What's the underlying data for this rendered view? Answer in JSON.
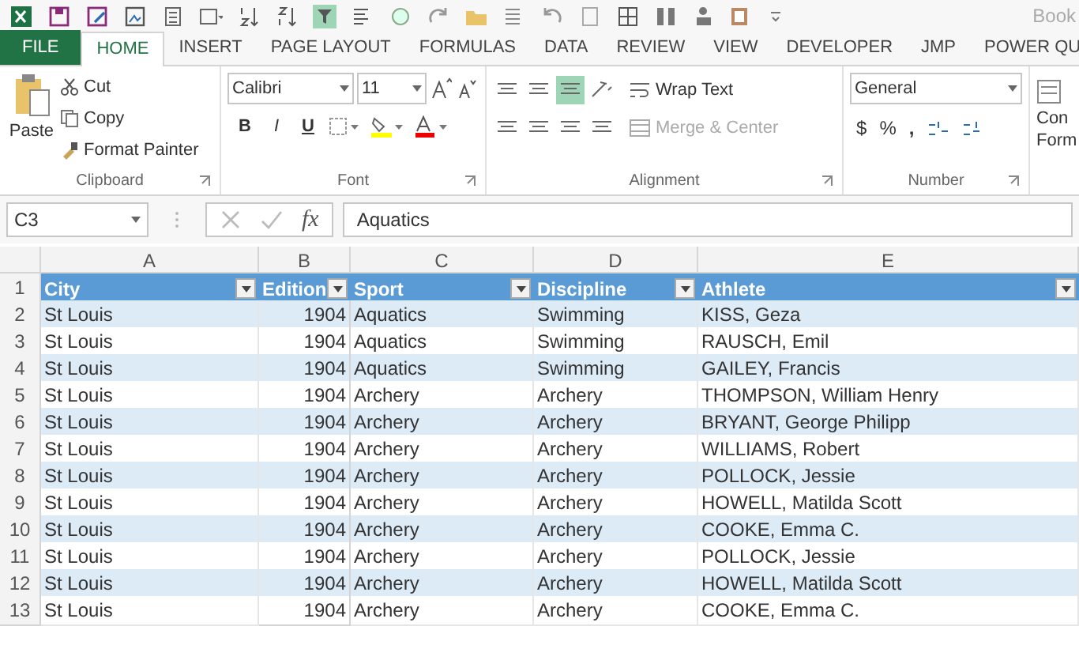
{
  "title_bar": {
    "title": "Book"
  },
  "tabs": [
    {
      "label": "FILE",
      "selected": false,
      "kind": "file"
    },
    {
      "label": "HOME",
      "selected": true,
      "kind": "tab"
    },
    {
      "label": "INSERT",
      "selected": false,
      "kind": "tab"
    },
    {
      "label": "PAGE LAYOUT",
      "selected": false,
      "kind": "tab"
    },
    {
      "label": "FORMULAS",
      "selected": false,
      "kind": "tab"
    },
    {
      "label": "DATA",
      "selected": false,
      "kind": "tab"
    },
    {
      "label": "REVIEW",
      "selected": false,
      "kind": "tab"
    },
    {
      "label": "VIEW",
      "selected": false,
      "kind": "tab"
    },
    {
      "label": "DEVELOPER",
      "selected": false,
      "kind": "tab"
    },
    {
      "label": "JMP",
      "selected": false,
      "kind": "tab"
    },
    {
      "label": "POWER QU",
      "selected": false,
      "kind": "tab"
    }
  ],
  "clipboard": {
    "paste": "Paste",
    "cut": "Cut",
    "copy": "Copy",
    "format_painter": "Format Painter",
    "label": "Clipboard"
  },
  "font": {
    "name": "Calibri",
    "size": "11",
    "bold": "B",
    "italic": "I",
    "underline": "U",
    "label": "Font"
  },
  "alignment": {
    "wrap_text": "Wrap Text",
    "merge": {
      "label": "Merge & Center",
      "disabled": true
    },
    "label": "Alignment"
  },
  "number": {
    "format": "General",
    "currency": "$",
    "percent": "%",
    "comma": ",",
    "label": "Number"
  },
  "group_5": {
    "lines": [
      "Con",
      "Form"
    ]
  },
  "formula_bar": {
    "name_box": "C3",
    "fx": "fx",
    "value": "Aquatics"
  },
  "sheet": {
    "columns": [
      "A",
      "B",
      "C",
      "D",
      "E"
    ],
    "header": {
      "row": "1",
      "cells": [
        "City",
        "Edition",
        "Sport",
        "Discipline",
        "Athlete"
      ]
    },
    "rows": [
      {
        "row": "2",
        "cells": [
          "St Louis",
          "1904",
          "Aquatics",
          "Swimming",
          "KISS, Geza"
        ]
      },
      {
        "row": "3",
        "cells": [
          "St Louis",
          "1904",
          "Aquatics",
          "Swimming",
          "RAUSCH, Emil"
        ]
      },
      {
        "row": "4",
        "cells": [
          "St Louis",
          "1904",
          "Aquatics",
          "Swimming",
          "GAILEY, Francis"
        ]
      },
      {
        "row": "5",
        "cells": [
          "St Louis",
          "1904",
          "Archery",
          "Archery",
          "THOMPSON, William Henry"
        ]
      },
      {
        "row": "6",
        "cells": [
          "St Louis",
          "1904",
          "Archery",
          "Archery",
          "BRYANT, George Philipp"
        ]
      },
      {
        "row": "7",
        "cells": [
          "St Louis",
          "1904",
          "Archery",
          "Archery",
          "WILLIAMS, Robert"
        ]
      },
      {
        "row": "8",
        "cells": [
          "St Louis",
          "1904",
          "Archery",
          "Archery",
          "POLLOCK, Jessie"
        ]
      },
      {
        "row": "9",
        "cells": [
          "St Louis",
          "1904",
          "Archery",
          "Archery",
          "HOWELL, Matilda Scott"
        ]
      },
      {
        "row": "10",
        "cells": [
          "St Louis",
          "1904",
          "Archery",
          "Archery",
          "COOKE, Emma C."
        ]
      },
      {
        "row": "11",
        "cells": [
          "St Louis",
          "1904",
          "Archery",
          "Archery",
          "POLLOCK, Jessie"
        ]
      },
      {
        "row": "12",
        "cells": [
          "St Louis",
          "1904",
          "Archery",
          "Archery",
          "HOWELL, Matilda Scott"
        ]
      },
      {
        "row": "13",
        "cells": [
          "St Louis",
          "1904",
          "Archery",
          "Archery",
          "COOKE, Emma C."
        ]
      }
    ]
  }
}
